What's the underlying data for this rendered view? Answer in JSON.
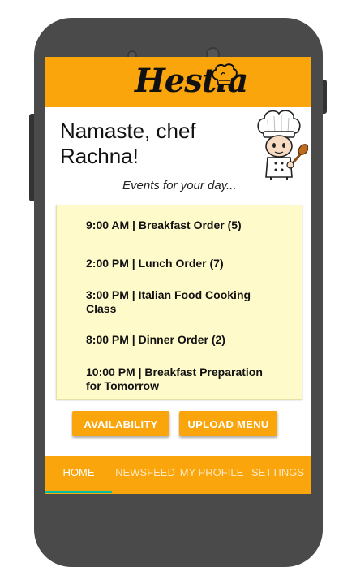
{
  "app": {
    "logo_text": "Hestia",
    "colors": {
      "primary": "#fba50c",
      "events_background": "#fffac9",
      "tab_indicator": "#00bfa5",
      "device_body": "#4a4a4a"
    }
  },
  "greeting": {
    "title": "Namaste, chef Rachna!",
    "subtitle": "Events for your day..."
  },
  "events": [
    {
      "label": "9:00 AM | Breakfast Order (5)"
    },
    {
      "label": "2:00 PM | Lunch Order (7)"
    },
    {
      "label": "3:00 PM | Italian Food Cooking Class"
    },
    {
      "label": "8:00 PM | Dinner Order (2)"
    },
    {
      "label": "10:00 PM | Breakfast Preparation for Tomorrow"
    }
  ],
  "actions": {
    "availability_label": "AVAILABILITY",
    "upload_menu_label": "UPLOAD MENU"
  },
  "tabs": [
    {
      "label": "HOME",
      "active": true
    },
    {
      "label": "NEWSFEED",
      "active": false
    },
    {
      "label": "MY PROFILE",
      "active": false
    },
    {
      "label": "SETTINGS",
      "active": false
    }
  ],
  "icons": {
    "logo_hat": "chef-hat-icon",
    "mascot": "chef-mascot-illustration"
  }
}
